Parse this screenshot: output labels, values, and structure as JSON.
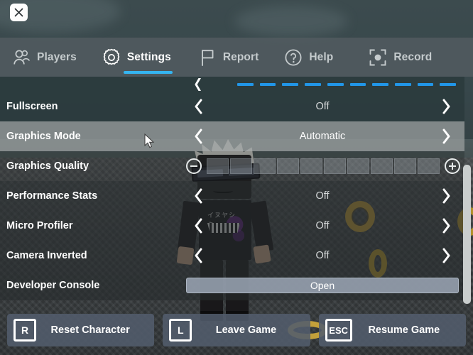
{
  "window": {
    "close_label": "Close",
    "close_icon": "close-icon"
  },
  "tabs": [
    {
      "id": "players",
      "label": "Players",
      "icon": "players-icon",
      "active": false
    },
    {
      "id": "settings",
      "label": "Settings",
      "icon": "gear-icon",
      "active": true
    },
    {
      "id": "report",
      "label": "Report",
      "icon": "flag-icon",
      "active": false
    },
    {
      "id": "help",
      "label": "Help",
      "icon": "question-icon",
      "active": false
    },
    {
      "id": "record",
      "label": "Record",
      "icon": "record-icon",
      "active": false
    }
  ],
  "settings": {
    "partial_row": {
      "type": "segments",
      "segments_total": 10,
      "segments_on": 10,
      "note": "clipped row above Fullscreen"
    },
    "rows": [
      {
        "id": "fullscreen",
        "label": "Fullscreen",
        "type": "stepper",
        "value": "Off",
        "hovered": false
      },
      {
        "id": "graphics-mode",
        "label": "Graphics Mode",
        "type": "stepper",
        "value": "Automatic",
        "hovered": true
      },
      {
        "id": "graphics-quality",
        "label": "Graphics Quality",
        "type": "slider",
        "segments_total": 10,
        "segments_on": 0,
        "minus_label": "Decrease",
        "plus_label": "Increase",
        "hovered": false
      },
      {
        "id": "performance-stats",
        "label": "Performance Stats",
        "type": "stepper",
        "value": "Off",
        "hovered": false
      },
      {
        "id": "micro-profiler",
        "label": "Micro Profiler",
        "type": "stepper",
        "value": "Off",
        "hovered": false
      },
      {
        "id": "camera-inverted",
        "label": "Camera Inverted",
        "type": "stepper",
        "value": "Off",
        "hovered": false
      },
      {
        "id": "developer-console",
        "label": "Developer Console",
        "type": "button",
        "button_label": "Open",
        "hovered": false
      }
    ]
  },
  "actions": [
    {
      "id": "reset-character",
      "key": "R",
      "label": "Reset Character"
    },
    {
      "id": "leave-game",
      "key": "L",
      "label": "Leave Game"
    },
    {
      "id": "resume-game",
      "key": "ESC",
      "label": "Resume Game"
    }
  ],
  "scene": {
    "avatar_shirt_text": "イヌヤシキ"
  },
  "colors": {
    "accent_blue": "#35b5f0",
    "row_dark": "#2b3a3d",
    "row_hover": "#969b9b",
    "button_gray": "#525c6c",
    "text_white": "#ffffff",
    "value_gray": "#d6d9da"
  }
}
